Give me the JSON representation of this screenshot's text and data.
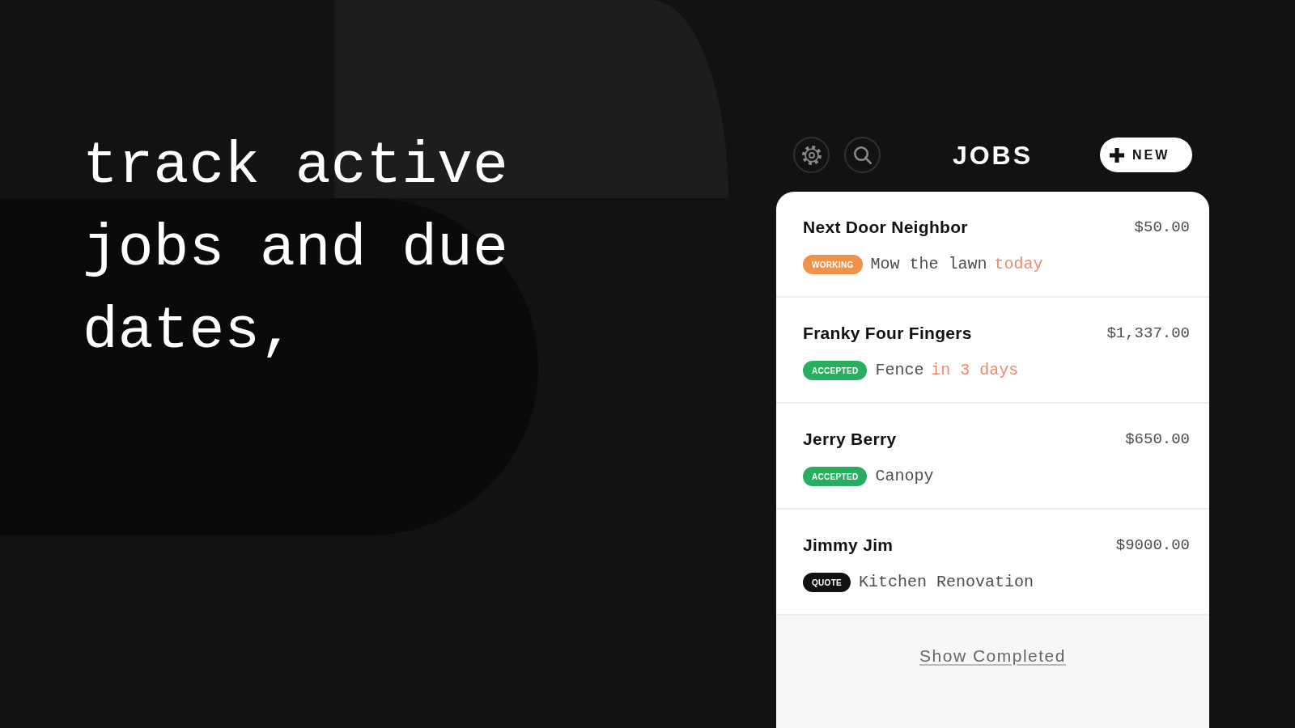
{
  "headline": "track active jobs and due dates,",
  "header": {
    "title": "JOBS",
    "new_button": "NEW"
  },
  "jobs": [
    {
      "client": "Next Door Neighbor",
      "price": "$50.00",
      "status": {
        "label": "WORKING",
        "color": "#f0914a"
      },
      "description": "Mow the lawn",
      "due": "today"
    },
    {
      "client": "Franky Four Fingers",
      "price": "$1,337.00",
      "status": {
        "label": "ACCEPTED",
        "color": "#27ae5f"
      },
      "description": "Fence",
      "due": "in 3 days"
    },
    {
      "client": "Jerry Berry",
      "price": "$650.00",
      "status": {
        "label": "ACCEPTED",
        "color": "#27ae5f"
      },
      "description": "Canopy"
    },
    {
      "client": "Jimmy Jim",
      "price": "$9000.00",
      "status": {
        "label": "QUOTE",
        "color": "#111111"
      },
      "description": "Kitchen Renovation"
    }
  ],
  "footer_link": "Show Completed"
}
